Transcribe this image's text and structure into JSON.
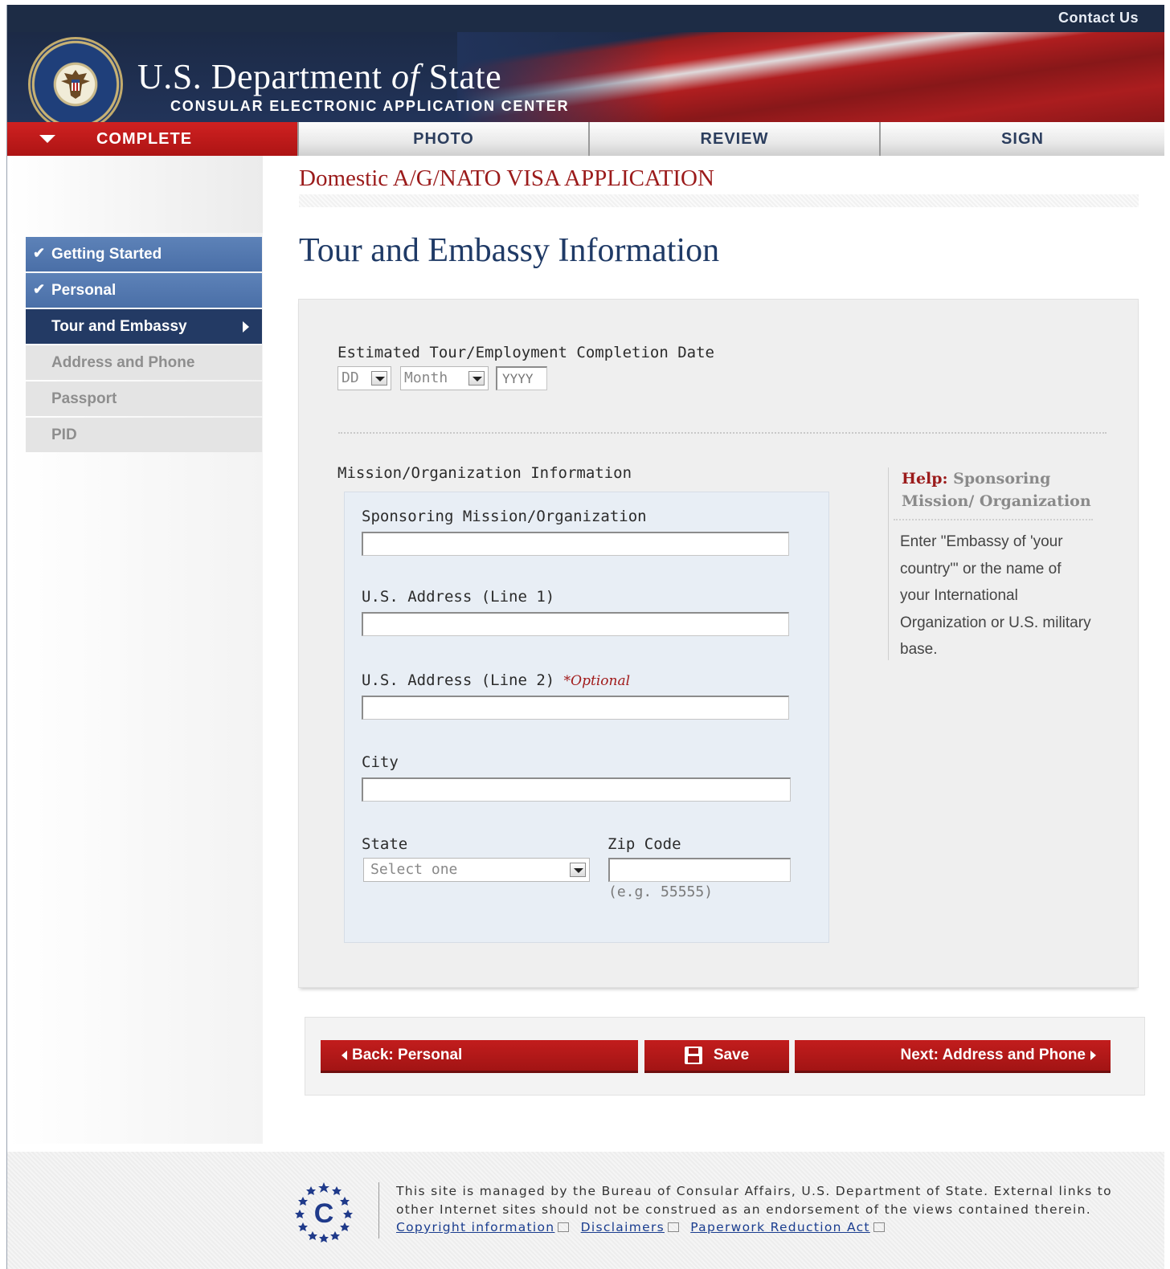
{
  "header": {
    "contact": "Contact Us",
    "title_prefix": "U.S. Department ",
    "title_of": "of",
    "title_suffix": " State",
    "subtitle": "CONSULAR ELECTRONIC APPLICATION CENTER",
    "seal_icon": "state-department-seal-icon"
  },
  "tabs": [
    {
      "label": "COMPLETE",
      "active": true
    },
    {
      "label": "PHOTO",
      "active": false
    },
    {
      "label": "REVIEW",
      "active": false
    },
    {
      "label": "SIGN",
      "active": false
    }
  ],
  "sidebar": {
    "items": [
      {
        "label": "Getting Started",
        "state": "done"
      },
      {
        "label": "Personal",
        "state": "done"
      },
      {
        "label": "Tour and Embassy",
        "state": "current"
      },
      {
        "label": "Address and Phone",
        "state": "todo"
      },
      {
        "label": "Passport",
        "state": "todo"
      },
      {
        "label": "PID",
        "state": "todo"
      }
    ]
  },
  "main": {
    "application_type": "Domestic A/G/NATO VISA APPLICATION",
    "page_title": "Tour and Embassy Information",
    "completion_date": {
      "label": "Estimated Tour/Employment Completion Date",
      "day": "DD",
      "month": "Month",
      "year_placeholder": "YYYY"
    },
    "mission": {
      "section_label": "Mission/Organization Information",
      "sponsoring_label": "Sponsoring Mission/Organization",
      "address1_label": "U.S. Address (Line 1)",
      "address2_label": "U.S. Address (Line 2)",
      "optional": "*Optional",
      "city_label": "City",
      "state_label": "State",
      "state_value": "Select one",
      "zip_label": "Zip Code",
      "zip_hint": "(e.g. 55555)"
    },
    "help": {
      "title_prefix": "Help:",
      "title": " Sponsoring Mission/ Organization",
      "body": "Enter \"Embassy of 'your country'\" or the name of your International Organization or U.S. military base."
    }
  },
  "buttons": {
    "back": "Back:  Personal",
    "save": "Save",
    "next": "Next: Address and Phone"
  },
  "footer": {
    "text": "This site is managed by the Bureau of Consular Affairs, U.S. Department of State. External links to other Internet sites should not be construed as an endorsement of the views contained therein.",
    "links": [
      "Copyright information",
      "Disclaimers",
      "Paperwork Reduction Act"
    ]
  },
  "colors": {
    "accent_red": "#a21414",
    "navy": "#1f3a66",
    "nav_done": "#4a6fa7",
    "nav_current": "#233a64"
  }
}
